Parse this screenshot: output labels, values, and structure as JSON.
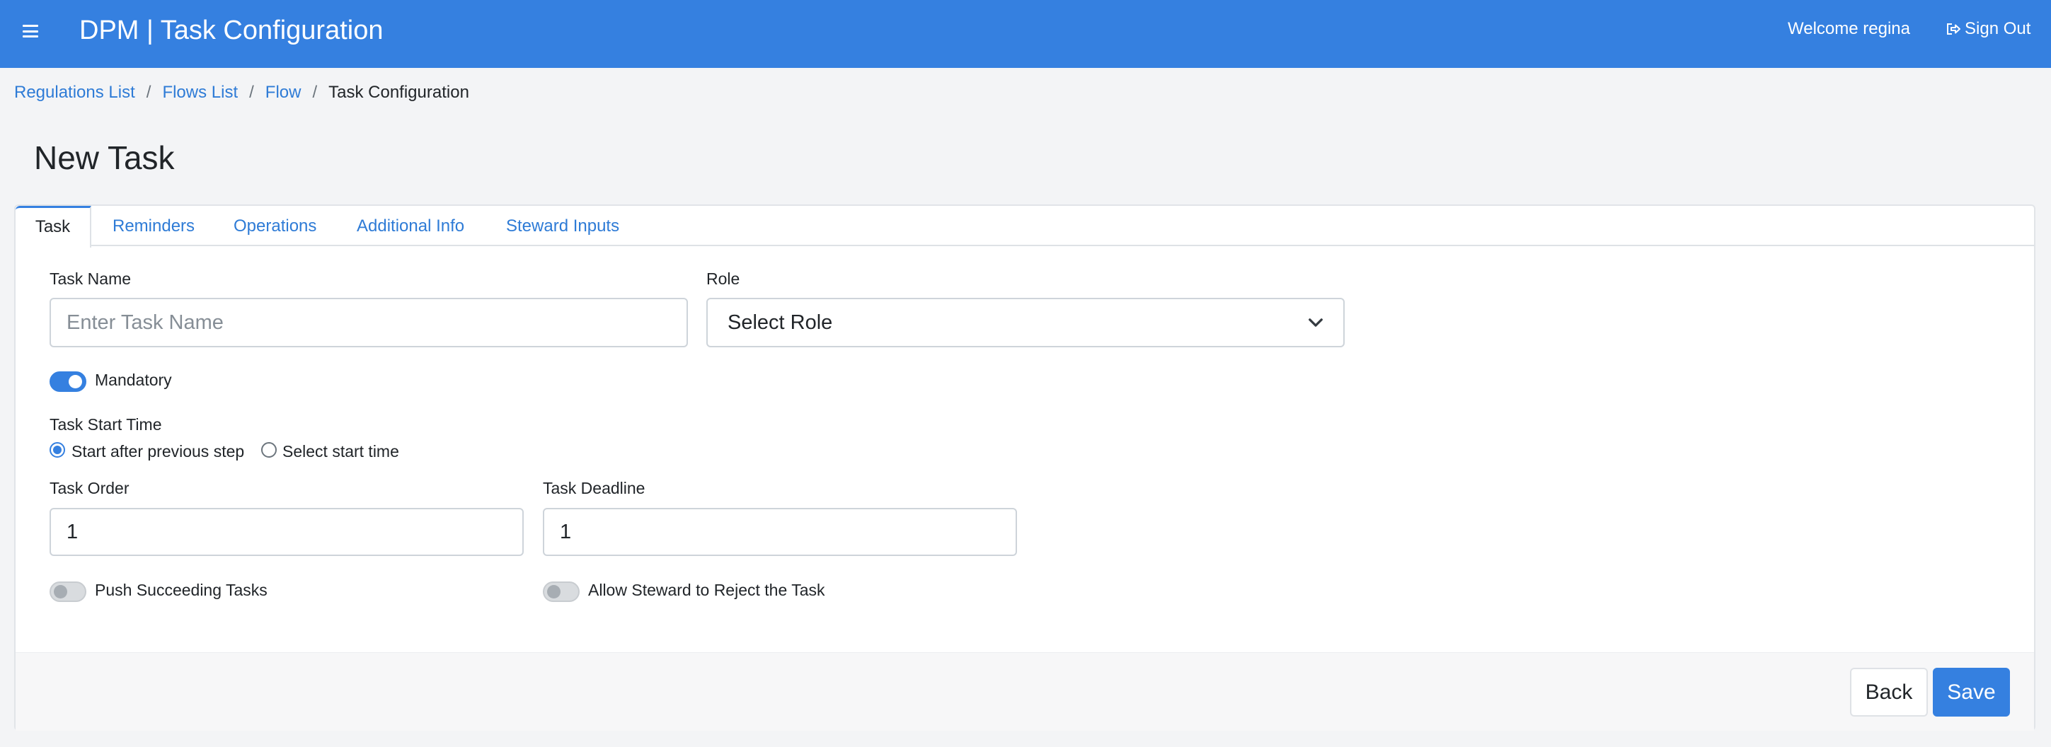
{
  "header": {
    "title": "DPM | Task Configuration",
    "welcome": "Welcome regina",
    "sign_out": "Sign Out",
    "bg_color": "#3580e0"
  },
  "breadcrumb": {
    "items": [
      "Regulations List",
      "Flows List",
      "Flow"
    ],
    "current": "Task Configuration",
    "separator": "/"
  },
  "page": {
    "title": "New Task"
  },
  "tabs": [
    {
      "label": "Task",
      "active": true
    },
    {
      "label": "Reminders",
      "active": false
    },
    {
      "label": "Operations",
      "active": false
    },
    {
      "label": "Additional Info",
      "active": false
    },
    {
      "label": "Steward Inputs",
      "active": false
    }
  ],
  "form": {
    "task_name": {
      "label": "Task Name",
      "placeholder": "Enter Task Name",
      "value": ""
    },
    "role": {
      "label": "Role",
      "selected": "Select Role"
    },
    "mandatory": {
      "label": "Mandatory",
      "checked": true
    },
    "start_time": {
      "label": "Task Start Time",
      "options": [
        "Start after previous step",
        "Select start time"
      ],
      "selected": "Start after previous step"
    },
    "task_order": {
      "label": "Task Order",
      "value": "1"
    },
    "task_deadline": {
      "label": "Task Deadline",
      "value": "1"
    },
    "push_succeeding": {
      "label": "Push Succeeding Tasks",
      "checked": false
    },
    "allow_reject": {
      "label": "Allow Steward to Reject the Task",
      "checked": false
    }
  },
  "actions": {
    "back": "Back",
    "save": "Save"
  },
  "icons": {
    "menu": "hamburger-menu-icon",
    "sign_out": "sign-out-icon",
    "select": "chevron-down-icon"
  }
}
